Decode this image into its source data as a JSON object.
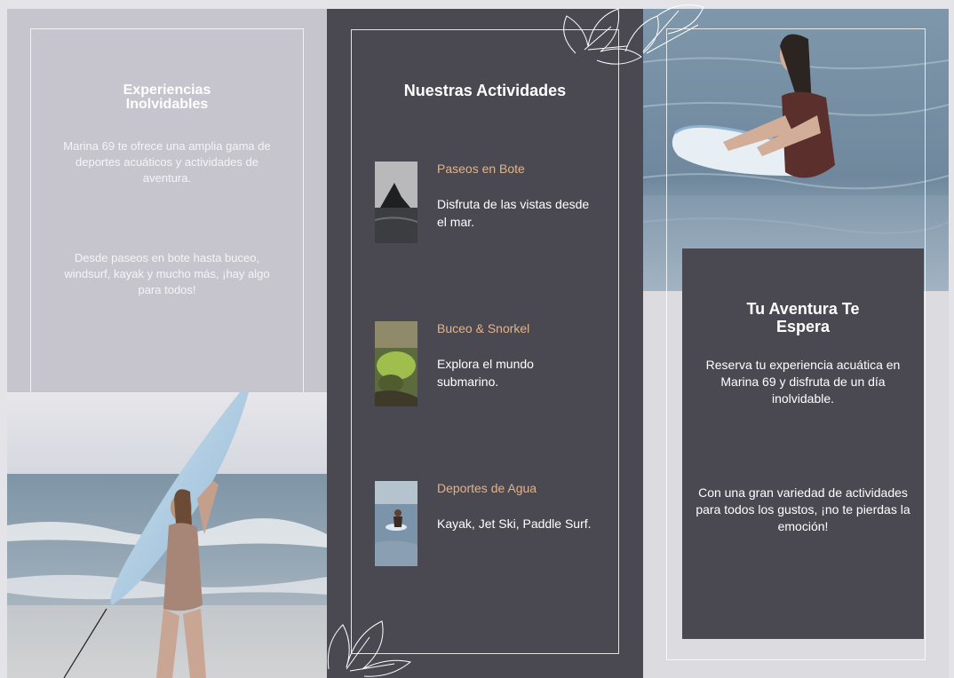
{
  "left_panel": {
    "title": "Experiencias\nInolvidables",
    "paragraph1": "Marina 69 te ofrece una amplia gama de deportes acuáticos y actividades de aventura.",
    "paragraph2": "Desde paseos en bote hasta buceo, windsurf, kayak y mucho más, ¡hay algo para todos!"
  },
  "middle_panel": {
    "heading": "Nuestras Actividades",
    "activities": [
      {
        "name": "Paseos en Bote",
        "description": "Disfruta de las vistas desde el mar."
      },
      {
        "name": "Buceo & Snorkel",
        "description": "Explora el mundo submarino."
      },
      {
        "name": "Deportes de Agua",
        "description": "Kayak, Jet Ski, Paddle Surf."
      }
    ]
  },
  "right_panel": {
    "title": "Tu Aventura Te\nEspera",
    "paragraph1": "Reserva tu experiencia acuática en Marina 69 y disfruta de un día inolvidable.",
    "paragraph2": "Con una gran variedad de actividades para todos los gustos, ¡no te pierdas la emoción!"
  },
  "colors": {
    "dark_panel": "#4a4951",
    "light_panel": "#c6c4cd",
    "accent": "#e0b38c"
  }
}
